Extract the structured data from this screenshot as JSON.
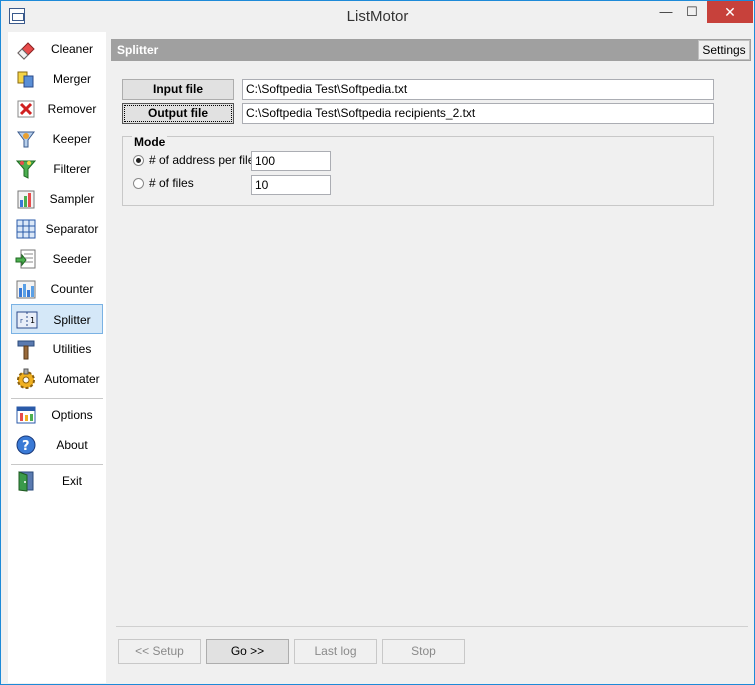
{
  "window": {
    "title": "ListMotor",
    "minimize": "—",
    "maximize": "☐",
    "close": "✕"
  },
  "sidebar": {
    "items": [
      {
        "label": "Cleaner",
        "icon": "eraser-icon"
      },
      {
        "label": "Merger",
        "icon": "merge-icon"
      },
      {
        "label": "Remover",
        "icon": "remove-icon"
      },
      {
        "label": "Keeper",
        "icon": "keeper-icon"
      },
      {
        "label": "Filterer",
        "icon": "filter-icon"
      },
      {
        "label": "Sampler",
        "icon": "sampler-icon"
      },
      {
        "label": "Separator",
        "icon": "grid-icon"
      },
      {
        "label": "Seeder",
        "icon": "seeder-icon"
      },
      {
        "label": "Counter",
        "icon": "counter-icon"
      },
      {
        "label": "Splitter",
        "icon": "splitter-icon",
        "active": true
      },
      {
        "label": "Utilities",
        "icon": "hammer-icon"
      },
      {
        "label": "Automater",
        "icon": "gear-icon"
      },
      {
        "label": "Options",
        "icon": "options-icon"
      },
      {
        "label": "About",
        "icon": "help-icon"
      },
      {
        "label": "Exit",
        "icon": "exit-door-icon"
      }
    ]
  },
  "panel": {
    "title": "Splitter",
    "settings_label": "Settings",
    "input_file_label": "Input file",
    "input_file_value": "C:\\Softpedia Test\\Softpedia.txt",
    "output_file_label": "Output file",
    "output_file_value": "C:\\Softpedia Test\\Softpedia recipients_2.txt",
    "mode": {
      "title": "Mode",
      "option1_label": "# of address per file",
      "option1_value": "100",
      "option2_label": "# of files",
      "option2_value": "10",
      "selected": "option1"
    }
  },
  "footer": {
    "setup_label": "<< Setup",
    "go_label": "Go >>",
    "lastlog_label": "Last log",
    "stop_label": "Stop"
  }
}
